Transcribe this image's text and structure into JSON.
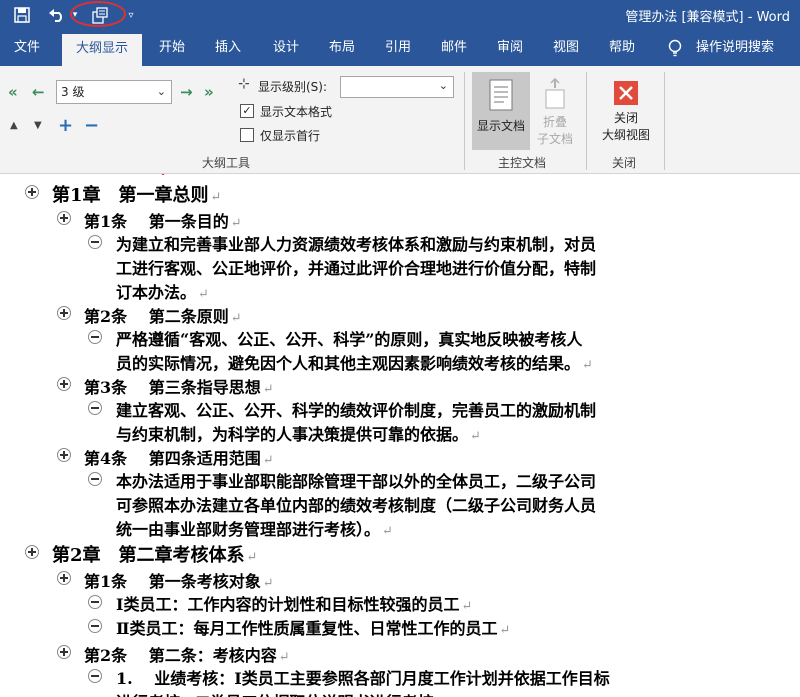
{
  "window": {
    "doc_title": "管理办法 [兼容模式]  -  Word"
  },
  "quick_access": {
    "save_icon": "save-icon",
    "undo_icon": "undo-icon",
    "undo_dropdown_icon": "chevron-down-icon",
    "outline_icon": "outline-view-icon",
    "customize_icon": "chevron-down-icon"
  },
  "tabs": [
    "文件",
    "大纲显示",
    "开始",
    "插入",
    "设计",
    "布局",
    "引用",
    "邮件",
    "审阅",
    "视图",
    "帮助"
  ],
  "active_tab_index": 1,
  "tell_me": "操作说明搜索",
  "ribbon": {
    "outline_tools": {
      "level_value": "3 级",
      "show_level_label": "显示级别(S):",
      "show_level_value": "",
      "show_text_format_label": "显示文本格式",
      "show_text_format_checked": true,
      "show_first_line_label": "仅显示首行",
      "show_first_line_checked": false,
      "group_label": "大纲工具"
    },
    "master_document": {
      "show_document_label": "显示文档",
      "collapse_label_1": "折叠",
      "collapse_label_2": "子文档",
      "group_label": "主控文档"
    },
    "close": {
      "close_label_1": "关闭",
      "close_label_2": "大纲视图",
      "group_label": "关闭"
    }
  },
  "document": {
    "ch1_title": "第1章　第一章总则",
    "art1_title": "第1条　 第一条目的",
    "art1_body_1": "为建立和完善事业部人力资源绩效考核体系和激励与约束机制，对员",
    "art1_body_2": "工进行客观、公正地评价，并通过此评价合理地进行价值分配，特制",
    "art1_body_3": "订本办法。",
    "art2_title": "第2条　 第二条原则",
    "art2_body_1": "严格遵循“客观、公正、公开、科学”的原则，真实地反映被考核人",
    "art2_body_2": "员的实际情况，避免因个人和其他主观因素影响绩效考核的结果。",
    "art3_title": "第3条　 第三条指导思想",
    "art3_body_1": "建立客观、公正、公开、科学的绩效评价制度，完善员工的激励机制",
    "art3_body_2": "与约束机制，为科学的人事决策提供可靠的依据。",
    "art4_title": "第4条　 第四条适用范围",
    "art4_body_1": "本办法适用于事业部职能部除管理干部以外的全体员工，二级子公司",
    "art4_body_2": "可参照本办法建立各单位内部的绩效考核制度（二级子公司财务人员",
    "art4_body_3": "统一由事业部财务管理部进行考核）。",
    "ch2_title": "第2章　第二章考核体系",
    "ch2_art1_title": "第1条　 第一条考核对象",
    "ch2_art1_body_1": "Ⅰ类员工：工作内容的计划性和目标性较强的员工",
    "ch2_art1_body_2": "Ⅱ类员工：每月工作性质属重复性、日常性工作的员工",
    "ch2_art2_title": "第2条　 第二条：考核内容",
    "ch2_art2_body_1": "1.　 业绩考核：Ⅰ类员工主要参照各部门月度工作计划并依据工作目标",
    "ch2_art2_body_2": "进行考核，Ⅱ类员工依据职位说明书进行考核。",
    "paragraph_mark": "↵"
  },
  "colors": {
    "title_bar": "#2b579a",
    "ribbon_bg": "#f3f3f3",
    "annotation": "#e03030",
    "close_icon_red": "#e04b3c"
  }
}
